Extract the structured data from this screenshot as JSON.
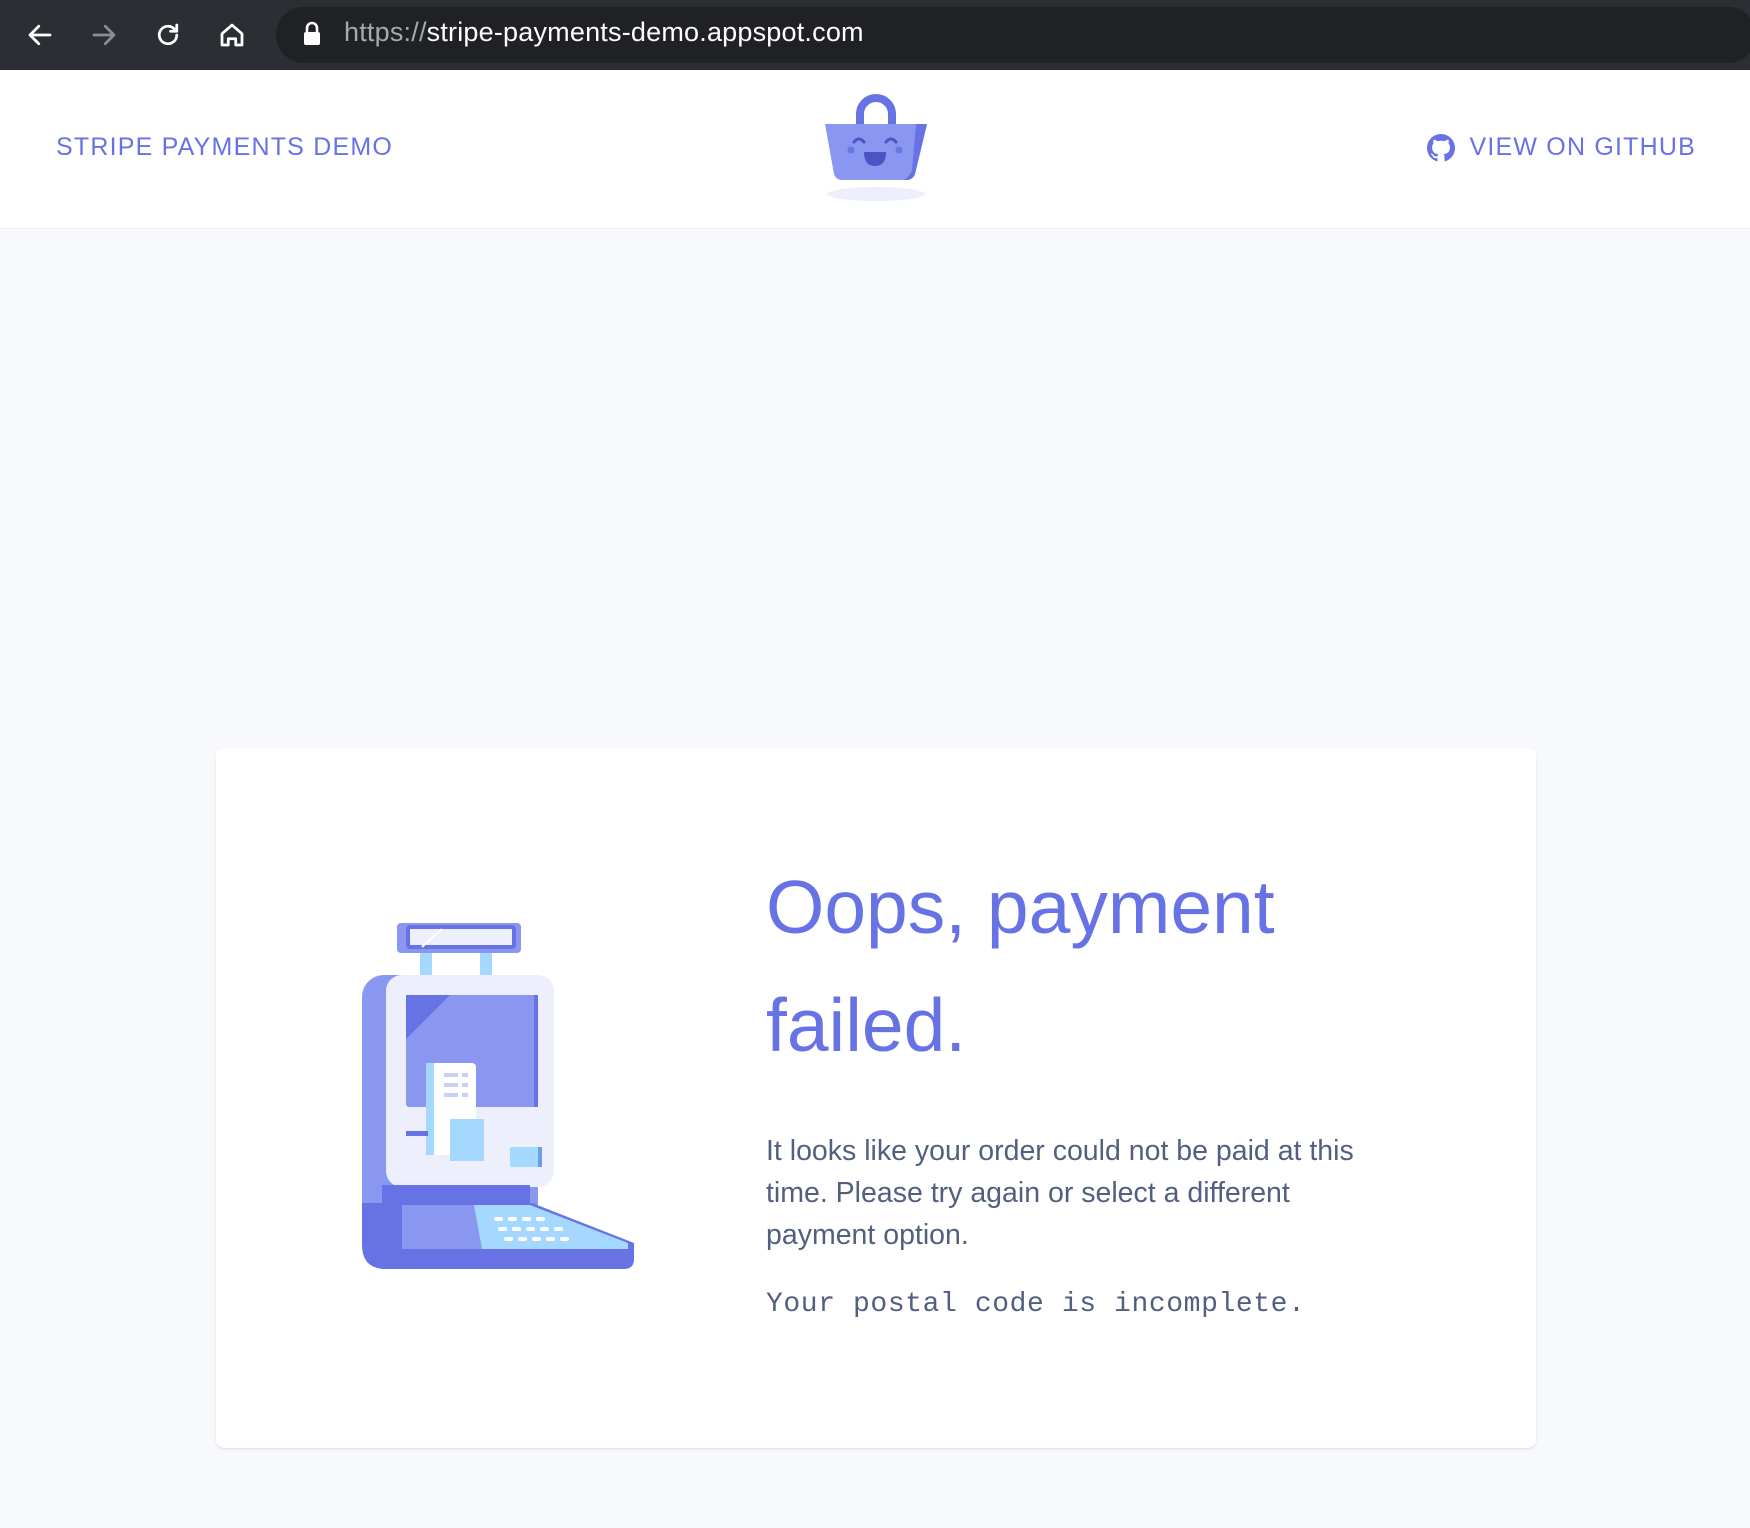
{
  "browser": {
    "url_scheme": "https://",
    "url_host": "stripe-payments-demo.appspot.com"
  },
  "header": {
    "brand": "STRIPE PAYMENTS DEMO",
    "github_label": "VIEW ON GITHUB"
  },
  "status": {
    "title": "Oops, payment failed.",
    "message": "It looks like your order could not be paid at this time. Please try again or select a different payment option.",
    "error": "Your postal code is incomplete."
  },
  "colors": {
    "accent": "#6772e5",
    "text": "#525f7f",
    "background": "#f7f9fc",
    "browser_chrome": "#2b2e33"
  },
  "icons": [
    "back-arrow-icon",
    "forward-arrow-icon",
    "reload-icon",
    "home-icon",
    "lock-icon",
    "basket-logo-icon",
    "github-icon",
    "payment-terminal-illustration"
  ]
}
